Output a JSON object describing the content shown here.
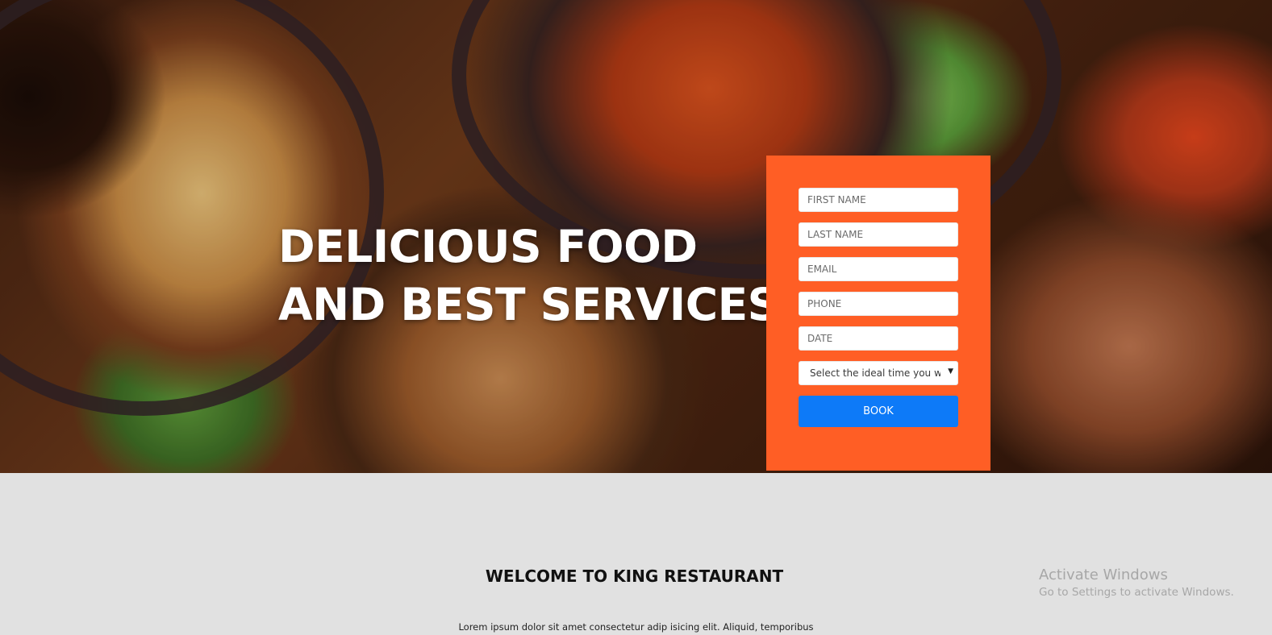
{
  "hero": {
    "headline_line1": "DELICIOUS FOOD",
    "headline_line2": "AND BEST SERVICES"
  },
  "booking_form": {
    "accent_color": "#ff5e25",
    "button_color": "#0d7af8",
    "first_name_placeholder": "FIRST NAME",
    "last_name_placeholder": "LAST NAME",
    "email_placeholder": "EMAIL",
    "phone_placeholder": "PHONE",
    "date_placeholder": "DATE",
    "time_select_value": "Select the ideal time you wc",
    "book_label": "BOOK"
  },
  "welcome": {
    "title": "WELCOME TO KING RESTAURANT",
    "body": "Lorem ipsum dolor sit amet consectetur adip isicing elit. Aliquid, temporibus"
  },
  "os_watermark": {
    "title": "Activate Windows",
    "subtitle": "Go to Settings to activate Windows."
  }
}
